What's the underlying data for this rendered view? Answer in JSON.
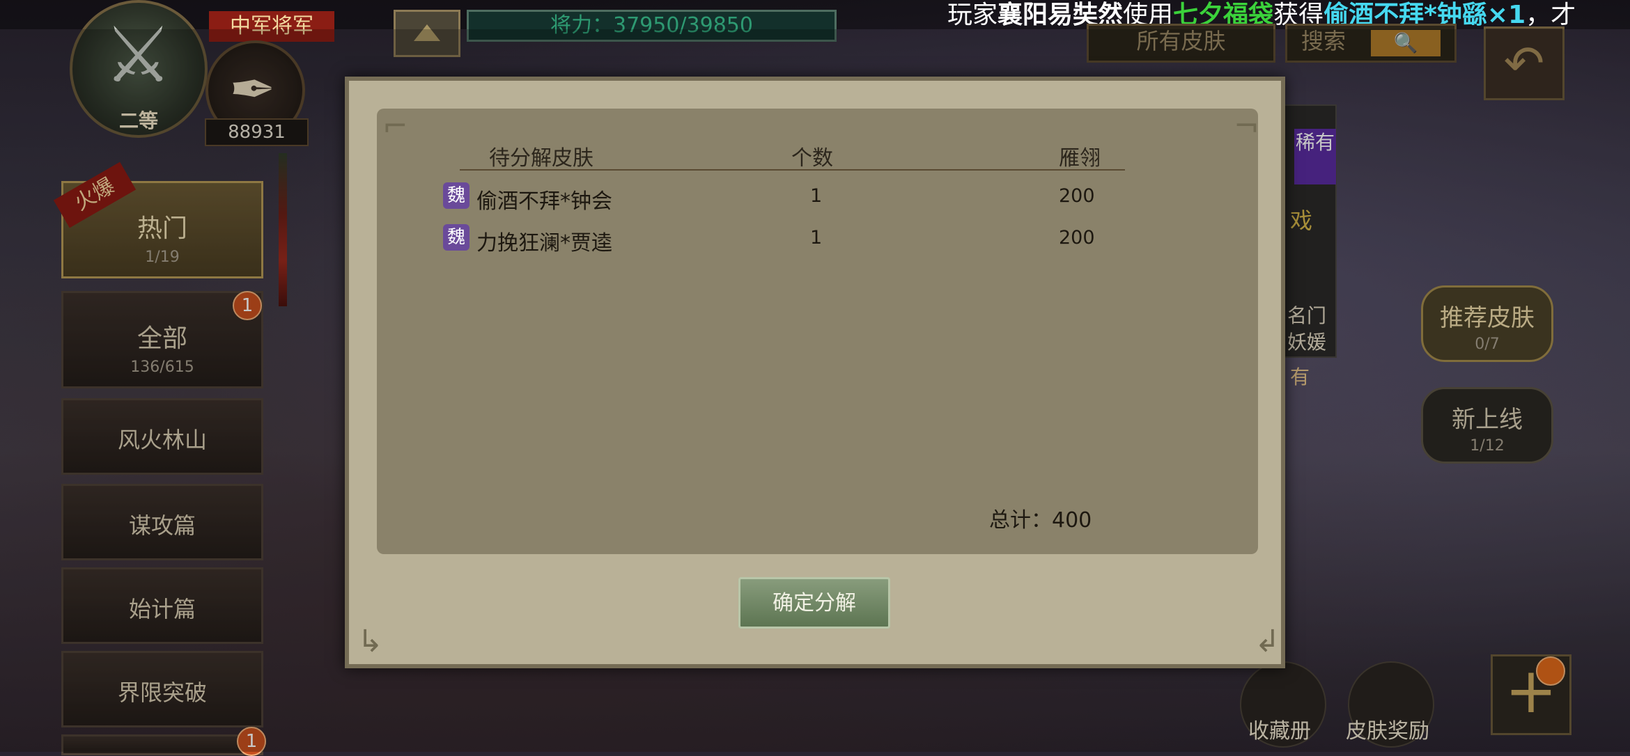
{
  "topbar": {
    "ticker_parts": [
      {
        "text": "玩家",
        "style": "normal"
      },
      {
        "text": "襄阳易奘然",
        "style": "bold"
      },
      {
        "text": "使用",
        "style": "normal"
      },
      {
        "text": "七夕福袋",
        "style": "green"
      },
      {
        "text": "获得",
        "style": "normal"
      },
      {
        "text": "偷酒不拜*钟繇×1",
        "style": "cyan"
      },
      {
        "text": "，才",
        "style": "normal"
      }
    ],
    "power_text": "将力：37950/39850"
  },
  "player": {
    "rank_label": "二等",
    "title_banner": "中军将军",
    "avatar_quill": "✒",
    "power_number": "88931"
  },
  "top_controls": {
    "skin_filter": "所有皮肤",
    "search_label": "搜索",
    "search_icon": "search-icon"
  },
  "sidebar": {
    "hot_tag": "火爆",
    "items": [
      {
        "label": "热门",
        "sub": "1/19",
        "selected": true
      },
      {
        "label": "全部",
        "sub": "136/615",
        "badge": "1"
      },
      {
        "label": "风火林山",
        "sub": ""
      },
      {
        "label": "谋攻篇",
        "sub": ""
      },
      {
        "label": "始计篇",
        "sub": ""
      },
      {
        "label": "界限突破",
        "sub": ""
      },
      {
        "label": "",
        "sub": "",
        "badge": "1"
      }
    ]
  },
  "right_panel": {
    "recommend": {
      "label": "推荐皮肤",
      "sub": "0/7"
    },
    "new_online": {
      "label": "新上线",
      "sub": "1/12"
    },
    "rare_tag": "稀有",
    "card_text_1": "戏",
    "card_text_2": "名门",
    "card_text_3": "妖媛",
    "card_text_4": "有"
  },
  "bottom": {
    "album_label": "收藏册",
    "reward_label": "皮肤奖励"
  },
  "dialog": {
    "columns": [
      "待分解皮肤",
      "个数",
      "雁翎"
    ],
    "rows": [
      {
        "faction": "魏",
        "name": "偷酒不拜*钟会",
        "count": "1",
        "value": "200"
      },
      {
        "faction": "魏",
        "name": "力挽狂澜*贾逵",
        "count": "1",
        "value": "200"
      }
    ],
    "total": "总计：400",
    "confirm_label": "确定分解"
  },
  "colors": {
    "dialog_bg": "#b9b197",
    "inner_bg": "#8a826a",
    "confirm_green": "#5d7552",
    "wei_purple": "#6a4a9a",
    "badge_orange": "#c8501e"
  }
}
